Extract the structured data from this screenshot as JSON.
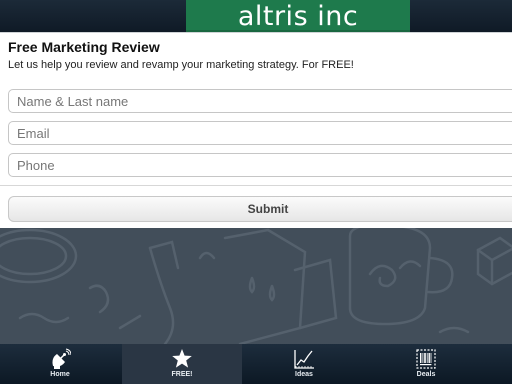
{
  "header": {
    "logo_text": "altris inc"
  },
  "form": {
    "title": "Free Marketing Review",
    "subtitle": "Let us help you review and revamp your marketing strategy. For FREE!",
    "fields": [
      {
        "placeholder": "Name & Last name",
        "value": ""
      },
      {
        "placeholder": "Email",
        "value": ""
      },
      {
        "placeholder": "Phone",
        "value": ""
      }
    ],
    "submit_label": "Submit"
  },
  "tabs": [
    {
      "label": "Home",
      "icon": "satellite-dish-icon",
      "active": false
    },
    {
      "label": "FREE!",
      "icon": "star-icon",
      "active": true
    },
    {
      "label": "Ideas",
      "icon": "line-chart-icon",
      "active": false
    },
    {
      "label": "Deals",
      "icon": "barcode-icon",
      "active": false
    }
  ],
  "colors": {
    "logo_bg": "#1e7a4c",
    "header_bg": "#0f1a26",
    "background_pattern": "#424e5a",
    "tabbar_bg": "#0c1824",
    "active_tab": "#2a3644"
  }
}
